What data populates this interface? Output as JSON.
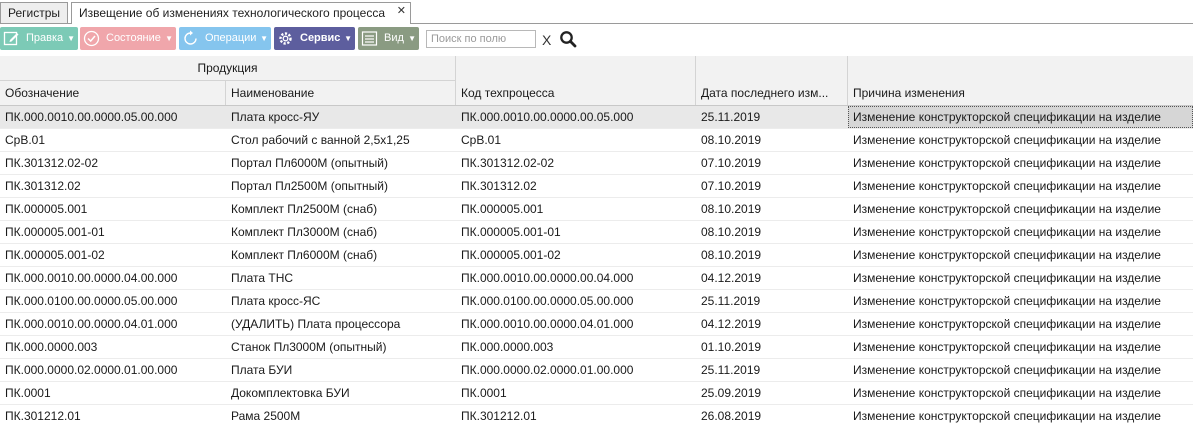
{
  "tabs": [
    {
      "label": "Регистры",
      "active": false
    },
    {
      "label": "Извещение об изменениях технологического процесса",
      "active": true,
      "close": "✕"
    }
  ],
  "toolbar": {
    "edit_label": "Правка",
    "state_label": "Состояние",
    "ops_label": "Операции",
    "service_label": "Сервис",
    "view_label": "Вид",
    "search_placeholder": "Поиск по полю",
    "clear_label": "X",
    "colors": {
      "edit": "#7ccab6",
      "state": "#f0a6ab",
      "ops": "#85c5ee",
      "service": "#5d5e9e",
      "view": "#8a9b82"
    },
    "icons": {
      "edit": "edit-icon",
      "state": "check-circle-icon",
      "ops": "refresh-icon",
      "service": "gear-icon",
      "view": "list-icon",
      "search": "search-icon"
    }
  },
  "grid": {
    "group_header": "Продукция",
    "columns": [
      "Обозначение",
      "Наименование",
      "Код техпроцесса",
      "Дата последнего изм...",
      "Причина изменения"
    ],
    "selected_row": 0,
    "rows": [
      [
        "ПК.000.0010.00.0000.05.00.000",
        "Плата кросс-ЯУ",
        "ПК.000.0010.00.0000.00.05.000",
        "25.11.2019",
        "Изменение конструкторской спецификации на изделие"
      ],
      [
        "СрВ.01",
        "Стол рабочий с ванной 2,5х1,25",
        "СрВ.01",
        "08.10.2019",
        "Изменение конструкторской спецификации на изделие"
      ],
      [
        "ПК.301312.02-02",
        "Портал Пл6000М (опытный)",
        "ПК.301312.02-02",
        "07.10.2019",
        "Изменение конструкторской спецификации на изделие"
      ],
      [
        "ПК.301312.02",
        "Портал Пл2500М (опытный)",
        "ПК.301312.02",
        "07.10.2019",
        "Изменение конструкторской спецификации на изделие"
      ],
      [
        "ПК.000005.001",
        "Комплект Пл2500М (снаб)",
        "ПК.000005.001",
        "08.10.2019",
        "Изменение конструкторской спецификации на изделие"
      ],
      [
        "ПК.000005.001-01",
        "Комплект Пл3000М (снаб)",
        "ПК.000005.001-01",
        "08.10.2019",
        "Изменение конструкторской спецификации на изделие"
      ],
      [
        "ПК.000005.001-02",
        "Комплект Пл6000М (снаб)",
        "ПК.000005.001-02",
        "08.10.2019",
        "Изменение конструкторской спецификации на изделие"
      ],
      [
        "ПК.000.0010.00.0000.04.00.000",
        "Плата ТНС",
        "ПК.000.0010.00.0000.00.04.000",
        "04.12.2019",
        "Изменение конструкторской спецификации на изделие"
      ],
      [
        "ПК.000.0100.00.0000.05.00.000",
        "Плата кросс-ЯС",
        "ПК.000.0100.00.0000.05.00.000",
        "25.11.2019",
        "Изменение конструкторской спецификации на изделие"
      ],
      [
        "ПК.000.0010.00.0000.04.01.000",
        "(УДАЛИТЬ) Плата процессора",
        "ПК.000.0010.00.0000.04.01.000",
        "04.12.2019",
        "Изменение конструкторской спецификации на изделие"
      ],
      [
        "ПК.000.0000.003",
        "Станок Пл3000М (опытный)",
        "ПК.000.0000.003",
        "01.10.2019",
        "Изменение конструкторской спецификации на изделие"
      ],
      [
        "ПК.000.0000.02.0000.01.00.000",
        "Плата БУИ",
        "ПК.000.0000.02.0000.01.00.000",
        "25.11.2019",
        "Изменение конструкторской спецификации на изделие"
      ],
      [
        "ПК.0001",
        "Докомплектовка БУИ",
        "ПК.0001",
        "25.09.2019",
        "Изменение конструкторской спецификации на изделие"
      ],
      [
        "ПК.301212.01",
        "Рама 2500М",
        "ПК.301212.01",
        "26.08.2019",
        "Изменение конструкторской спецификации на изделие"
      ]
    ]
  }
}
